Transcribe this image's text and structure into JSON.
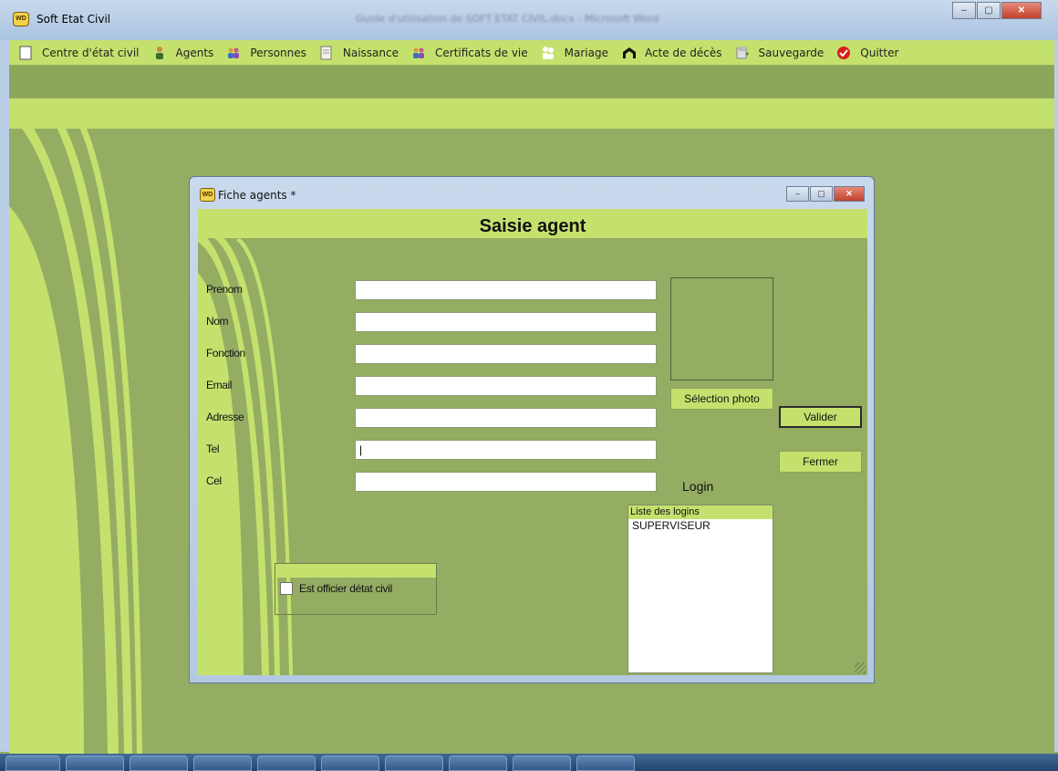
{
  "window": {
    "title": "Soft Etat Civil",
    "background_title": "Guide d'utilisation de SOFT ETAT CIVIL.docx - Microsoft Word",
    "minimize": "–",
    "maximize": "▢",
    "close": "✕"
  },
  "menu": [
    {
      "label": "Centre d'état civil",
      "icon": "building-icon"
    },
    {
      "label": "Agents",
      "icon": "person-icon"
    },
    {
      "label": "Personnes",
      "icon": "people-icon"
    },
    {
      "label": "Naissance",
      "icon": "document-icon"
    },
    {
      "label": "Certificats de vie",
      "icon": "people-icon"
    },
    {
      "label": "Mariage",
      "icon": "couple-icon"
    },
    {
      "label": "Acte de décès",
      "icon": "death-act-icon"
    },
    {
      "label": "Sauvegarde",
      "icon": "save-icon"
    },
    {
      "label": "Quitter",
      "icon": "quit-icon"
    }
  ],
  "dialog": {
    "title": "Fiche agents *",
    "heading": "Saisie agent",
    "fields": [
      {
        "label": "Prenom",
        "value": ""
      },
      {
        "label": "Nom",
        "value": ""
      },
      {
        "label": "Fonction",
        "value": ""
      },
      {
        "label": "Email",
        "value": ""
      },
      {
        "label": "Adresse",
        "value": ""
      },
      {
        "label": "Tel",
        "value": "|"
      },
      {
        "label": "Cel",
        "value": ""
      }
    ],
    "photo_button": "Sélection photo",
    "validate_button": "Valider",
    "close_button": "Fermer",
    "login_label": "Login",
    "logins_list": {
      "header": "Liste des logins",
      "items": [
        "SUPERVISEUR"
      ]
    },
    "officer_checkbox": {
      "label": "Est officier détat civil",
      "checked": false
    }
  },
  "colors": {
    "panel_light": "#c5e16d",
    "panel_dark": "#94ad63",
    "title_blue": "#b9cfe6"
  }
}
